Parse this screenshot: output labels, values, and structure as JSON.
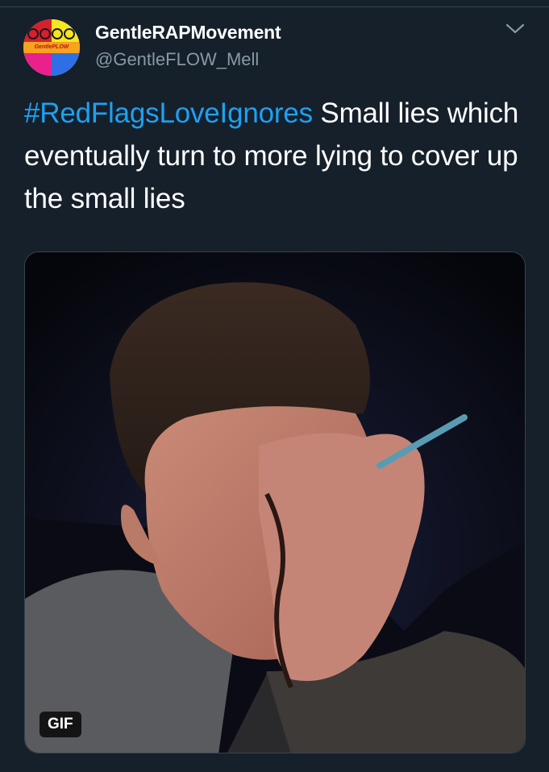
{
  "tweet": {
    "display_name": "GentleRAPMovement",
    "handle": "@GentleFLOW_Mell",
    "hashtag": "#RedFlagsLoveIgnores",
    "body": " Small lies which eventually turn to more lying to cover up the small lies",
    "avatar_text": "GentlePLOW",
    "menu_icon": "chevron-down-icon"
  },
  "media": {
    "badge": "GIF"
  },
  "colors": {
    "background": "#15202b",
    "link": "#1da1f2",
    "secondary_text": "#8899a6"
  }
}
